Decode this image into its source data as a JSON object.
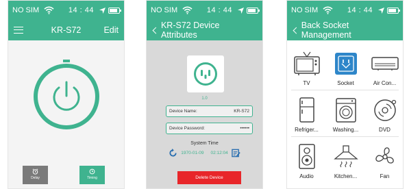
{
  "status_bar": {
    "carrier": "NO SIM",
    "time": "14 : 44"
  },
  "colors": {
    "accent": "#3fb38f",
    "danger": "#e8262a",
    "grey_button": "#7a7a7a"
  },
  "screen_main": {
    "title": "KR-S72",
    "edit_label": "Edit",
    "delay_label": "Delay",
    "timing_label": "Timing"
  },
  "screen_attributes": {
    "title": "KR-S72  Device Attributes",
    "version": "1.0",
    "device_name_label": "Device Name:",
    "device_name_value": "KR-S72",
    "device_password_label": "Device  Password:",
    "device_password_value": "••••••",
    "system_time_label": "System Time",
    "system_date": "1970-01-09",
    "system_clock": "02:12:04",
    "delete_label": "Delete Device"
  },
  "screen_socket": {
    "title": "Back Socket Management",
    "items": [
      {
        "label": "TV",
        "icon": "tv-icon",
        "selected": false
      },
      {
        "label": "Socket",
        "icon": "socket-icon",
        "selected": true
      },
      {
        "label": "Air Con...",
        "icon": "air-conditioner-icon",
        "selected": false
      },
      {
        "label": "Refriger...",
        "icon": "refrigerator-icon",
        "selected": false
      },
      {
        "label": "Washing...",
        "icon": "washing-machine-icon",
        "selected": false
      },
      {
        "label": "DVD",
        "icon": "dvd-icon",
        "selected": false
      },
      {
        "label": "Audio",
        "icon": "speaker-icon",
        "selected": false
      },
      {
        "label": "Kitchen...",
        "icon": "range-hood-icon",
        "selected": false
      },
      {
        "label": "Fan",
        "icon": "fan-icon",
        "selected": false
      }
    ]
  }
}
